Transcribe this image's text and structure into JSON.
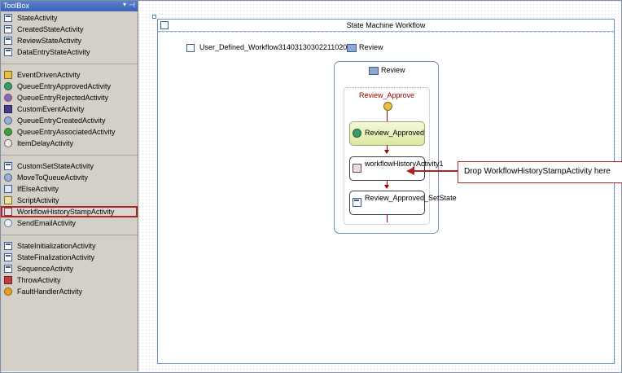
{
  "toolbox": {
    "title": "ToolBox",
    "dropdown_glyph": "▾",
    "pin_glyph": "⊣",
    "groups": [
      {
        "items": [
          {
            "label": "StateActivity",
            "icon": "state-icon"
          },
          {
            "label": "CreatedStateActivity",
            "icon": "state-icon"
          },
          {
            "label": "ReviewStateActivity",
            "icon": "state-icon"
          },
          {
            "label": "DataEntryStateActivity",
            "icon": "state-icon"
          }
        ]
      },
      {
        "items": [
          {
            "label": "EventDrivenActivity",
            "icon": "event-driven-icon"
          },
          {
            "label": "QueueEntryApprovedActivity",
            "icon": "queue-approved-icon"
          },
          {
            "label": "QueueEntryRejectedActivity",
            "icon": "queue-rejected-icon"
          },
          {
            "label": "CustomEventActivity",
            "icon": "custom-event-icon"
          },
          {
            "label": "QueueEntryCreatedActivity",
            "icon": "queue-created-icon"
          },
          {
            "label": "QueueEntryAssociatedActivity",
            "icon": "queue-associated-icon"
          },
          {
            "label": "ItemDelayActivity",
            "icon": "delay-icon"
          }
        ]
      },
      {
        "items": [
          {
            "label": "CustomSetStateActivity",
            "icon": "set-state-icon"
          },
          {
            "label": "MoveToQueueActivity",
            "icon": "move-queue-icon"
          },
          {
            "label": "IfElseActivity",
            "icon": "if-else-icon"
          },
          {
            "label": "ScriptActivity",
            "icon": "script-icon"
          },
          {
            "label": "WorkflowHistoryStampActivity",
            "icon": "history-stamp-icon",
            "selected": true
          },
          {
            "label": "SendEmailActivity",
            "icon": "send-email-icon"
          }
        ]
      },
      {
        "items": [
          {
            "label": "StateInitializationActivity",
            "icon": "state-init-icon"
          },
          {
            "label": "StateFinalizationActivity",
            "icon": "state-final-icon"
          },
          {
            "label": "SequenceActivity",
            "icon": "sequence-icon"
          },
          {
            "label": "ThrowActivity",
            "icon": "throw-icon"
          },
          {
            "label": "FaultHandlerActivity",
            "icon": "fault-handler-icon"
          }
        ]
      }
    ]
  },
  "designer": {
    "title": "State Machine Workflow",
    "workflow_name": "User_Defined_Workflow314031303022110200",
    "separator": ":",
    "initial_state": "Review",
    "state": {
      "title": "Review",
      "event_driven": {
        "title": "Review_Approve",
        "activities": [
          {
            "label": "Review_Approved",
            "icon": "queue-approved-icon"
          },
          {
            "label": "workflowHistoryActivity1",
            "icon": "history-stamp-icon"
          },
          {
            "label": "Review_Approved_SetState",
            "icon": "set-state-icon"
          }
        ]
      }
    },
    "callout": "Drop WorkflowHistoryStampActivity here"
  },
  "colors": {
    "callout_border": "#b22222",
    "toolbox_header": "#3a62b8",
    "event_title": "#a00000"
  }
}
